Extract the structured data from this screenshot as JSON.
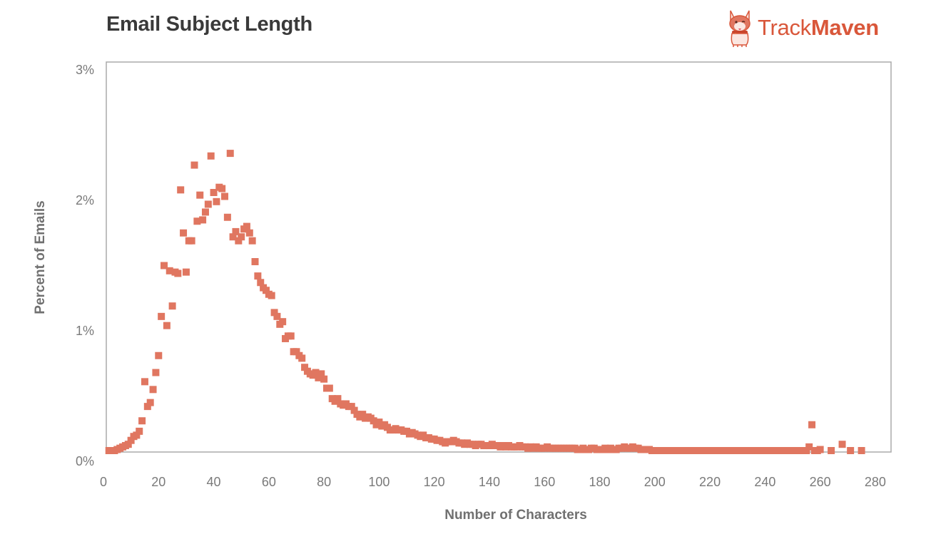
{
  "header": {
    "title": "Email Subject Length",
    "logo_brand_light": "Track",
    "logo_brand_bold": "Maven",
    "logo_icon": "corgi-mascot-icon"
  },
  "colors": {
    "marker": "#e07660",
    "brand": "#d9573a",
    "axis": "#aaaaaa",
    "text": "#7a7a7a",
    "title": "#3a3a3a"
  },
  "chart_data": {
    "type": "scatter",
    "title": "Email Subject Length",
    "xlabel": "Number of Characters",
    "ylabel": "Percent of Emails",
    "xlim": [
      0,
      285
    ],
    "ylim": [
      0,
      3
    ],
    "x_ticks": [
      0,
      20,
      40,
      60,
      80,
      100,
      120,
      140,
      160,
      180,
      200,
      220,
      240,
      260,
      280
    ],
    "x_tick_labels": [
      "0",
      "20",
      "40",
      "60",
      "80",
      "100",
      "120",
      "140",
      "160",
      "180",
      "200",
      "220",
      "240",
      "260",
      "280"
    ],
    "y_ticks": [
      0,
      1,
      2,
      3
    ],
    "y_tick_labels": [
      "0%",
      "1%",
      "2%",
      "3%"
    ],
    "grid": false,
    "legend": "none",
    "marker": "square",
    "series": [
      {
        "name": "Percent of Emails",
        "x": [
          2,
          3,
          4,
          5,
          6,
          7,
          8,
          9,
          10,
          11,
          12,
          13,
          14,
          15,
          16,
          17,
          18,
          19,
          20,
          21,
          22,
          23,
          24,
          25,
          26,
          27,
          28,
          29,
          30,
          31,
          32,
          33,
          34,
          35,
          36,
          37,
          38,
          39,
          40,
          41,
          42,
          43,
          44,
          45,
          46,
          47,
          48,
          49,
          50,
          51,
          52,
          53,
          54,
          55,
          56,
          57,
          58,
          59,
          60,
          61,
          62,
          63,
          64,
          65,
          66,
          67,
          68,
          69,
          70,
          71,
          72,
          73,
          74,
          75,
          76,
          77,
          78,
          79,
          80,
          81,
          82,
          83,
          84,
          85,
          86,
          87,
          88,
          89,
          90,
          91,
          92,
          93,
          94,
          95,
          96,
          97,
          98,
          99,
          100,
          101,
          102,
          103,
          104,
          105,
          106,
          107,
          108,
          109,
          110,
          111,
          112,
          113,
          114,
          115,
          116,
          117,
          118,
          119,
          120,
          121,
          122,
          123,
          124,
          125,
          126,
          127,
          128,
          129,
          130,
          131,
          132,
          133,
          134,
          135,
          136,
          137,
          138,
          139,
          140,
          141,
          142,
          143,
          144,
          145,
          146,
          147,
          148,
          149,
          150,
          151,
          152,
          153,
          154,
          155,
          156,
          157,
          158,
          159,
          160,
          161,
          162,
          163,
          164,
          165,
          166,
          167,
          168,
          169,
          170,
          171,
          172,
          173,
          174,
          175,
          176,
          177,
          178,
          179,
          180,
          181,
          182,
          183,
          184,
          185,
          186,
          187,
          188,
          189,
          190,
          191,
          192,
          193,
          194,
          195,
          196,
          197,
          198,
          199,
          200,
          201,
          202,
          203,
          204,
          205,
          206,
          207,
          208,
          209,
          210,
          211,
          212,
          213,
          214,
          215,
          216,
          217,
          218,
          219,
          220,
          221,
          222,
          223,
          224,
          225,
          226,
          227,
          228,
          229,
          230,
          231,
          232,
          233,
          234,
          235,
          236,
          237,
          238,
          239,
          240,
          241,
          242,
          243,
          244,
          245,
          246,
          247,
          248,
          249,
          250,
          251,
          252,
          253,
          254,
          255,
          256,
          257,
          258,
          259,
          260,
          264,
          268,
          271,
          275
        ],
        "y": [
          0.0,
          0.01,
          0.02,
          0.03,
          0.04,
          0.05,
          0.06,
          0.07,
          0.1,
          0.13,
          0.14,
          0.17,
          0.25,
          0.55,
          0.36,
          0.39,
          0.49,
          0.62,
          0.75,
          1.05,
          1.44,
          0.98,
          1.4,
          1.13,
          1.39,
          1.38,
          2.02,
          1.69,
          1.39,
          1.63,
          1.63,
          2.21,
          1.78,
          1.98,
          1.79,
          1.85,
          1.91,
          2.28,
          2.0,
          1.93,
          2.04,
          2.03,
          1.97,
          1.81,
          2.3,
          1.66,
          1.7,
          1.63,
          1.66,
          1.72,
          1.74,
          1.69,
          1.63,
          1.47,
          1.36,
          1.31,
          1.27,
          1.25,
          1.22,
          1.21,
          1.08,
          1.05,
          0.99,
          1.01,
          0.88,
          0.9,
          0.9,
          0.78,
          0.78,
          0.75,
          0.73,
          0.66,
          0.63,
          0.61,
          0.6,
          0.62,
          0.58,
          0.61,
          0.57,
          0.5,
          0.5,
          0.42,
          0.4,
          0.42,
          0.38,
          0.37,
          0.38,
          0.36,
          0.36,
          0.33,
          0.3,
          0.28,
          0.3,
          0.27,
          0.28,
          0.27,
          0.25,
          0.22,
          0.24,
          0.21,
          0.22,
          0.2,
          0.18,
          0.18,
          0.19,
          0.18,
          0.18,
          0.17,
          0.17,
          0.15,
          0.16,
          0.15,
          0.14,
          0.13,
          0.14,
          0.12,
          0.12,
          0.11,
          0.11,
          0.1,
          0.1,
          0.09,
          0.08,
          0.09,
          0.09,
          0.1,
          0.09,
          0.08,
          0.08,
          0.07,
          0.08,
          0.07,
          0.07,
          0.06,
          0.07,
          0.07,
          0.06,
          0.06,
          0.06,
          0.07,
          0.06,
          0.06,
          0.05,
          0.06,
          0.05,
          0.06,
          0.05,
          0.05,
          0.05,
          0.06,
          0.05,
          0.05,
          0.04,
          0.05,
          0.04,
          0.05,
          0.04,
          0.04,
          0.04,
          0.05,
          0.04,
          0.04,
          0.04,
          0.04,
          0.04,
          0.04,
          0.04,
          0.04,
          0.04,
          0.04,
          0.03,
          0.03,
          0.04,
          0.03,
          0.03,
          0.04,
          0.04,
          0.03,
          0.03,
          0.03,
          0.04,
          0.03,
          0.04,
          0.03,
          0.03,
          0.04,
          0.04,
          0.05,
          0.04,
          0.04,
          0.05,
          0.04,
          0.04,
          0.03,
          0.03,
          0.03,
          0.03,
          0.02,
          0.02,
          0.02,
          0.02,
          0.02,
          0.02,
          0.02,
          0.02,
          0.02,
          0.02,
          0.02,
          0.02,
          0.02,
          0.02,
          0.02,
          0.02,
          0.02,
          0.02,
          0.02,
          0.02,
          0.02,
          0.02,
          0.02,
          0.02,
          0.02,
          0.02,
          0.02,
          0.02,
          0.02,
          0.02,
          0.02,
          0.02,
          0.02,
          0.02,
          0.02,
          0.02,
          0.02,
          0.02,
          0.02,
          0.02,
          0.02,
          0.02,
          0.02,
          0.02,
          0.02,
          0.02,
          0.02,
          0.02,
          0.02,
          0.02,
          0.02,
          0.02,
          0.02,
          0.02,
          0.02,
          0.02,
          0.02,
          0.05,
          0.22,
          0.01,
          0.02,
          0.03,
          0.02,
          0.07,
          0.01,
          0.01,
          0.01,
          0.01
        ]
      }
    ]
  }
}
